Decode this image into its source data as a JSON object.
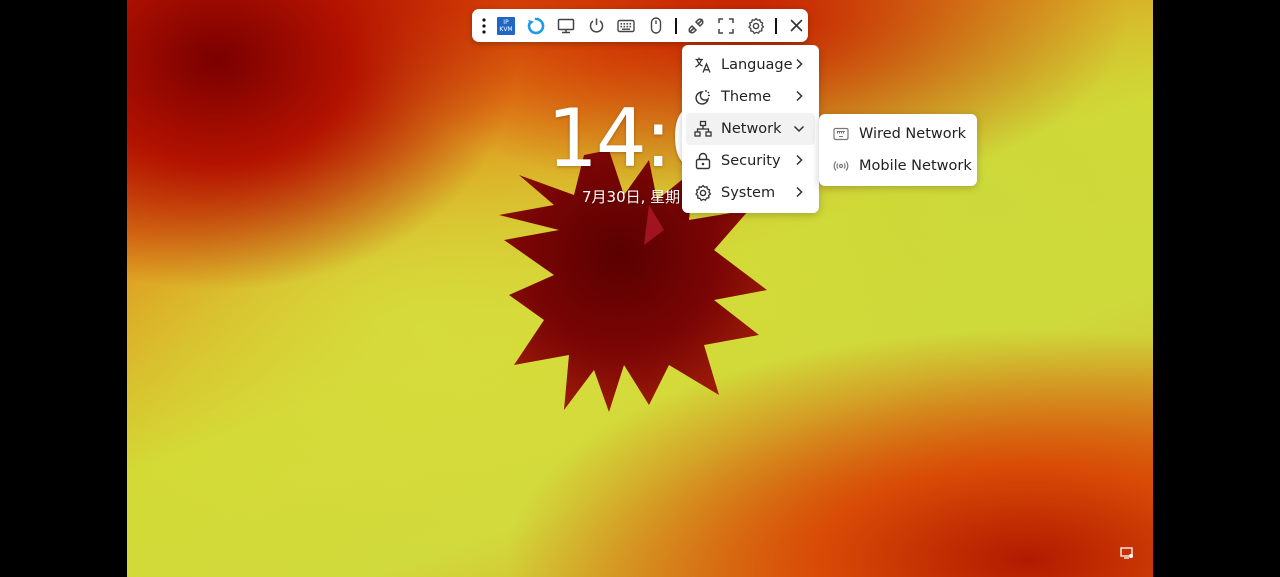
{
  "lockscreen": {
    "time": "14:0",
    "date": "7月30日, 星期"
  },
  "toolbar": {
    "kvm_badge_line1": "IP",
    "kvm_badge_line2": "KVM",
    "items": [
      {
        "name": "menu-dots-icon"
      },
      {
        "name": "ip-kvm-icon"
      },
      {
        "name": "sync-icon"
      },
      {
        "name": "monitor-icon"
      },
      {
        "name": "power-icon"
      },
      {
        "name": "keyboard-icon"
      },
      {
        "name": "mouse-icon"
      },
      {
        "name": "disconnect-icon"
      },
      {
        "name": "fullscreen-icon"
      },
      {
        "name": "settings-icon"
      },
      {
        "name": "close-icon"
      }
    ]
  },
  "settings_menu": {
    "items": [
      {
        "label": "Language",
        "icon": "translate-icon"
      },
      {
        "label": "Theme",
        "icon": "theme-icon"
      },
      {
        "label": "Network",
        "icon": "network-icon",
        "expanded": true
      },
      {
        "label": "Security",
        "icon": "lock-icon"
      },
      {
        "label": "System",
        "icon": "gear-icon"
      }
    ]
  },
  "network_submenu": {
    "items": [
      {
        "label": "Wired Network",
        "icon": "ethernet-icon"
      },
      {
        "label": "Mobile Network",
        "icon": "antenna-icon"
      }
    ]
  },
  "colors": {
    "kvm_badge": "#1f66c9",
    "sync_icon": "#1e9be6"
  }
}
